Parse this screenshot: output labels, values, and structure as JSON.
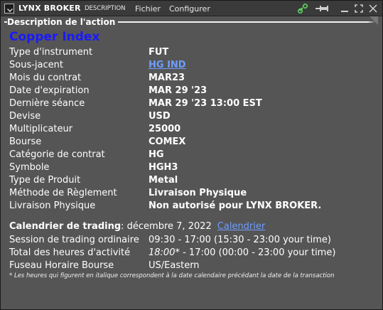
{
  "titlebar": {
    "brand": "LYNX BROKER",
    "tab": "DESCRIPTION",
    "menu": [
      "Fichier",
      "Configurer"
    ]
  },
  "section": {
    "title": "Description de l'action"
  },
  "instrument": {
    "title": "Copper Index",
    "rows": [
      {
        "label": "Type d'instrument",
        "value": "FUT"
      },
      {
        "label": "Sous-jacent",
        "value": "HG IND",
        "link": true
      },
      {
        "label": "Mois du contrat",
        "value": "MAR23"
      },
      {
        "label": "Date d'expiration",
        "value": "MAR 29 '23"
      },
      {
        "label": "Dernière séance",
        "value": "MAR 29 '23 13:00 EST"
      },
      {
        "label": "Devise",
        "value": "USD"
      },
      {
        "label": "Multiplicateur",
        "value": "25000"
      },
      {
        "label": "Bourse",
        "value": "COMEX"
      },
      {
        "label": "Catégorie de contrat",
        "value": "HG"
      },
      {
        "label": "Symbole",
        "value": "HGH3"
      },
      {
        "label": "Type de Produit",
        "value": "Metal"
      },
      {
        "label": "Méthode de Règlement",
        "value": "Livraison Physique"
      },
      {
        "label": "Livraison Physique",
        "value": "Non autorisé pour LYNX BROKER."
      }
    ]
  },
  "calendar": {
    "label": "Calendrier de trading",
    "date": "décembre 7, 2022",
    "link": "Calendrier",
    "session_label": "Session de trading ordinaire",
    "session_value": "09:30 - 17:00 (15:30 - 23:00 your time)",
    "total_label": "Total des heures d'activité",
    "total_italic": "18:00*",
    "total_rest": " - 17:00 (00:00 - 23:00 your time)",
    "tz_label": "Fuseau Horaire Bourse",
    "tz_value": "US/Eastern",
    "footnote": "* Les heures qui figurent en italique correspondent à la date calendaire précédant la date de la transaction"
  },
  "colors": {
    "title_blue": "#1a1aff",
    "link_blue": "#6f9dff",
    "panel_bg": "#555555"
  }
}
